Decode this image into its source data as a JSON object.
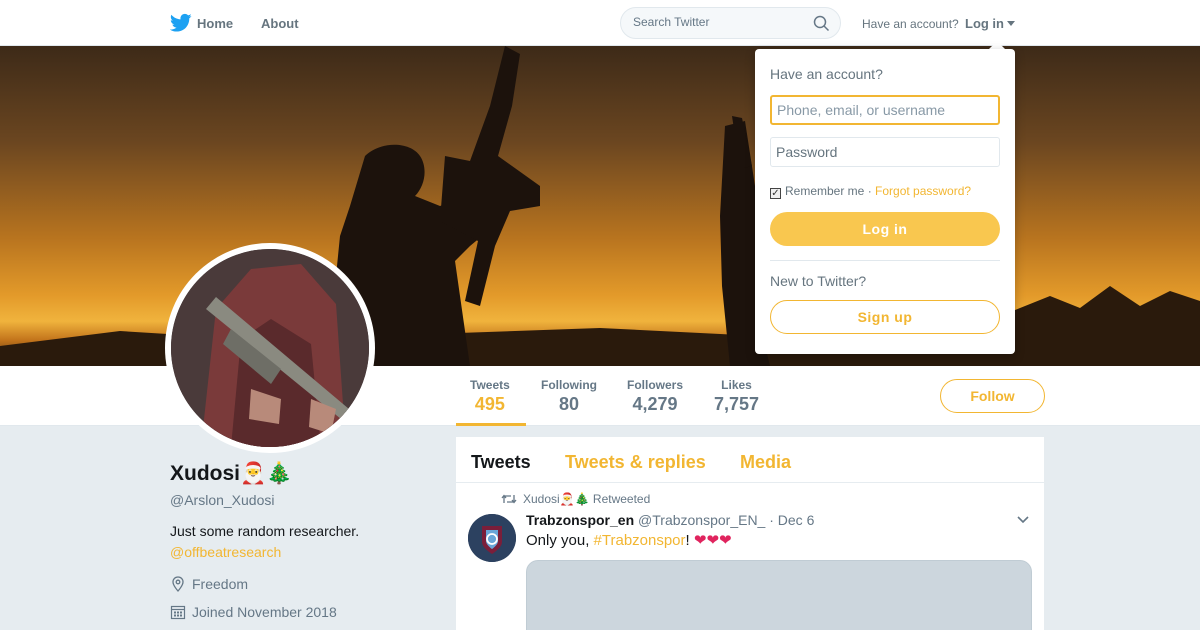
{
  "nav": {
    "home_label": "Home",
    "about_label": "About",
    "search_placeholder": "Search Twitter",
    "have_account": "Have an account?",
    "login_label": "Log in"
  },
  "profile": {
    "name": "Xudosi🎅🎄",
    "handle": "@Arslon_Xudosi",
    "bio": "Just some random researcher.",
    "link": "@offbeatresearch",
    "location": "Freedom",
    "joined": "Joined November 2018"
  },
  "stats": [
    {
      "label": "Tweets",
      "value": "495"
    },
    {
      "label": "Following",
      "value": "80"
    },
    {
      "label": "Followers",
      "value": "4,279"
    },
    {
      "label": "Likes",
      "value": "7,757"
    }
  ],
  "follow_label": "Follow",
  "timeline": {
    "tabs": [
      "Tweets",
      "Tweets & replies",
      "Media"
    ],
    "tweet": {
      "retweeted_by": "Xudosi🎅🎄 Retweeted",
      "author_name": "Trabzonspor_en",
      "author_handle": "@Trabzonspor_EN_",
      "date": "· Dec 6",
      "text_prefix": "Only you, ",
      "hashtag": "#Trabzonspor",
      "text_suffix": "! ",
      "hearts": "❤❤❤"
    }
  },
  "login_dropdown": {
    "title": "Have an account?",
    "username_placeholder": "Phone, email, or username",
    "password_placeholder": "Password",
    "remember_label": "Remember me",
    "separator": " · ",
    "forgot_label": "Forgot password?",
    "login_button": "Log in",
    "new_to_twitter": "New to Twitter?",
    "signup_button": "Sign up"
  },
  "colors": {
    "accent": "#f2b632",
    "text_primary": "#14171a",
    "text_secondary": "#657786",
    "background": "#e6ecf0",
    "twitter_blue": "#1da1f2"
  }
}
